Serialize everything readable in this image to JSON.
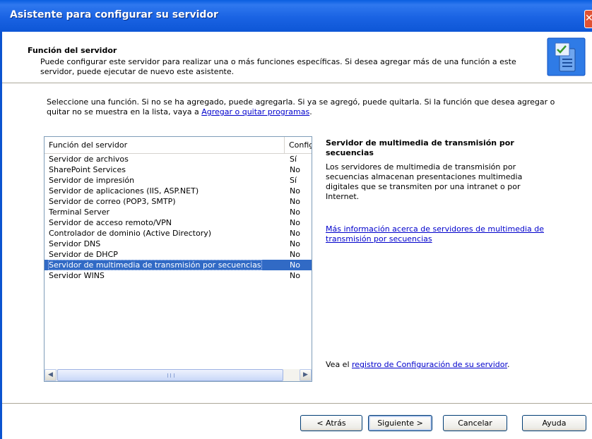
{
  "window": {
    "title": "Asistente para configurar su servidor",
    "close_glyph": "✕"
  },
  "header": {
    "title": "Función del servidor",
    "description": "Puede configurar este servidor para realizar una o más funciones específicas. Si desea agregar más de una función a este servidor, puede ejecutar de nuevo este asistente.",
    "icon": "server-wizard-icon"
  },
  "intro": {
    "text": "Seleccione una función. Si no se ha agregado, puede agregarla. Si ya se agregó, puede quitarla. Si la función que desea agregar o quitar no se muestra en la lista, vaya a ",
    "link": "Agregar o quitar programas",
    "suffix": "."
  },
  "list": {
    "columns": [
      "Función del servidor",
      "Configurado"
    ],
    "rows": [
      {
        "role": "Servidor de archivos",
        "configured": "Sí"
      },
      {
        "role": "SharePoint Services",
        "configured": "No"
      },
      {
        "role": "Servidor de impresión",
        "configured": "Sí"
      },
      {
        "role": "Servidor de aplicaciones (IIS, ASP.NET)",
        "configured": "No"
      },
      {
        "role": "Servidor de correo (POP3, SMTP)",
        "configured": "No"
      },
      {
        "role": "Terminal Server",
        "configured": "No"
      },
      {
        "role": "Servidor de acceso remoto/VPN",
        "configured": "No"
      },
      {
        "role": "Controlador de dominio (Active Directory)",
        "configured": "No"
      },
      {
        "role": "Servidor DNS",
        "configured": "No"
      },
      {
        "role": "Servidor de DHCP",
        "configured": "No"
      },
      {
        "role": "Servidor de multimedia de transmisión por secuencias",
        "configured": "No",
        "selected": true
      },
      {
        "role": "Servidor WINS",
        "configured": "No"
      }
    ],
    "scroll_left": "◀",
    "scroll_right": "▶"
  },
  "details": {
    "title": "Servidor de multimedia de transmisión por secuencias",
    "body": "Los servidores de multimedia de transmisión por secuencias almacenan presentaciones multimedia digitales que se transmiten por una intranet o por Internet.",
    "more_link": "Más información acerca de servidores de multimedia de transmisión por secuencias"
  },
  "log": {
    "prefix": "Vea el ",
    "link": "registro de Configuración de su servidor",
    "suffix": "."
  },
  "buttons": {
    "back": "< Atrás",
    "next": "Siguiente >",
    "cancel": "Cancelar",
    "help": "Ayuda"
  },
  "colors": {
    "titlebar": "#0a5ee0",
    "selection": "#316ac5",
    "link": "#0000cc"
  }
}
